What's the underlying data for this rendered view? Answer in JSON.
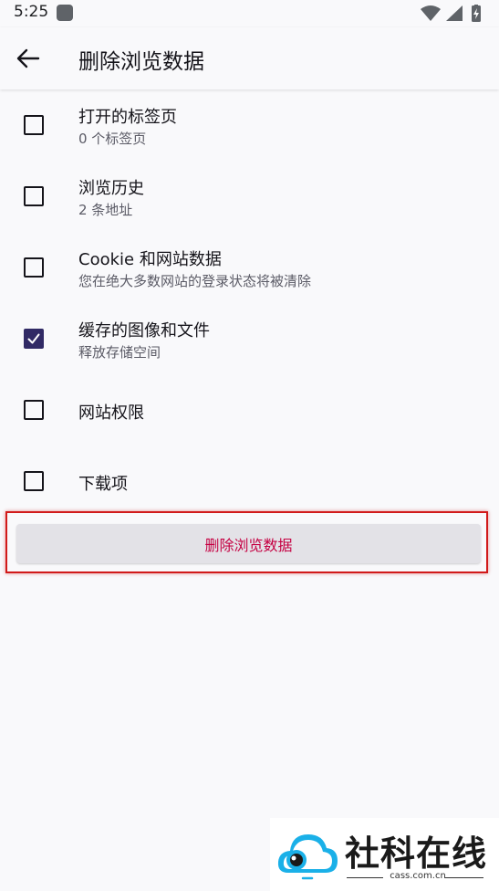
{
  "status_bar": {
    "time": "5:25"
  },
  "app_bar": {
    "title": "删除浏览数据"
  },
  "options": [
    {
      "label": "打开的标签页",
      "sub": "0 个标签页",
      "checked": false
    },
    {
      "label": "浏览历史",
      "sub": "2 条地址",
      "checked": false
    },
    {
      "label": "Cookie 和网站数据",
      "sub": "您在绝大多数网站的登录状态将被清除",
      "checked": false
    },
    {
      "label": "缓存的图像和文件",
      "sub": "释放存储空间",
      "checked": true
    },
    {
      "label": "网站权限",
      "checked": false
    },
    {
      "label": "下载项",
      "checked": false
    }
  ],
  "delete_button": {
    "label": "删除浏览数据"
  },
  "watermark": {
    "text": "社科在线",
    "url": "cass.com.cn"
  },
  "colors": {
    "accent": "#312a65",
    "danger_text": "#c50042",
    "highlight": "#d11a1a"
  }
}
